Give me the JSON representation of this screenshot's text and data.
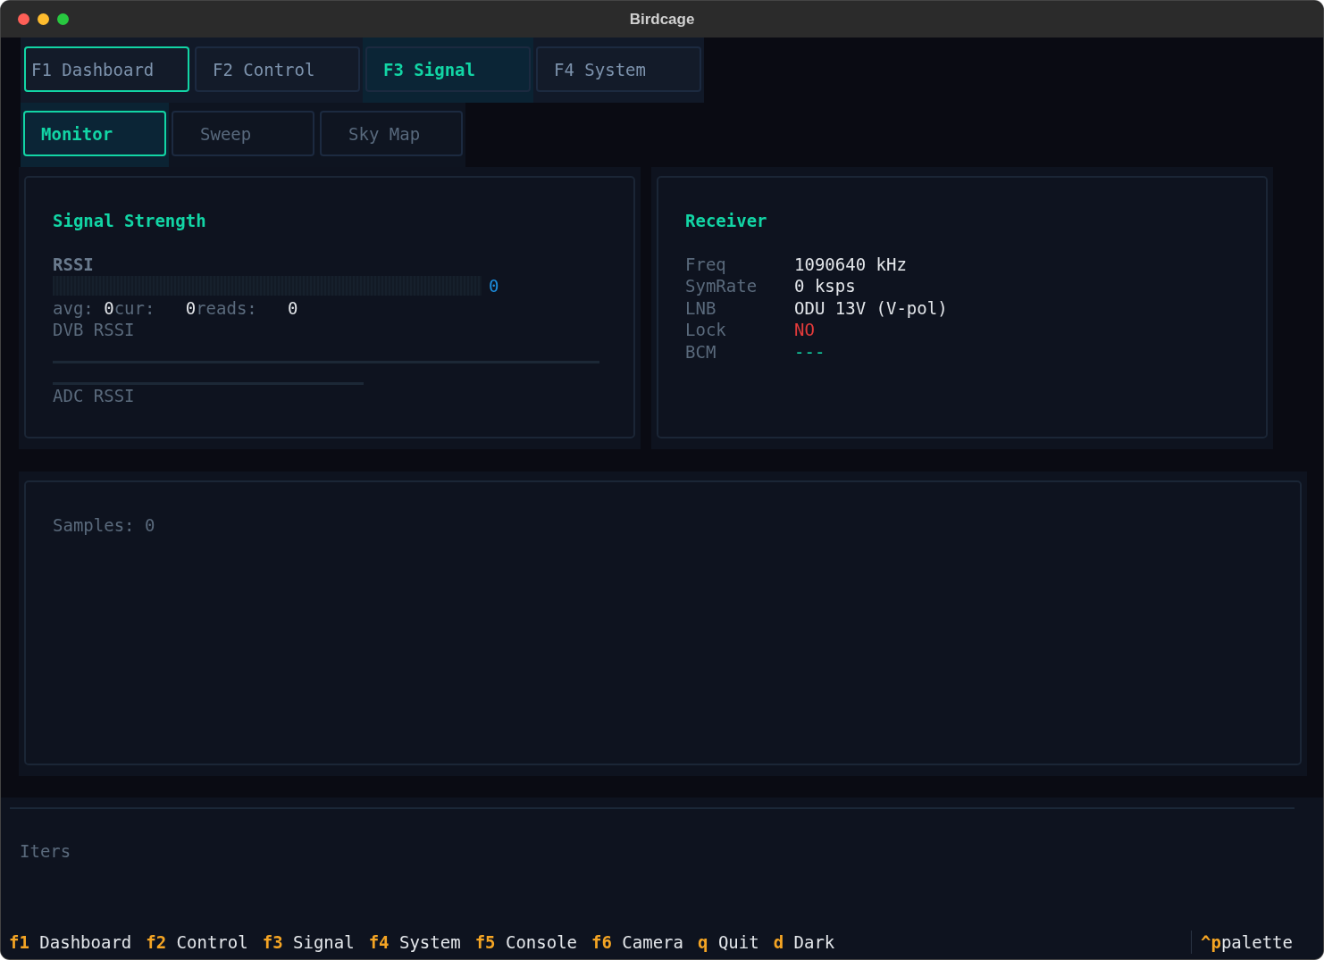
{
  "window": {
    "title": "Birdcage"
  },
  "tabs": [
    {
      "label": "F1 Dashboard",
      "selected": false,
      "focused": true
    },
    {
      "label": "F2 Control",
      "selected": false,
      "focused": false
    },
    {
      "label": "F3 Signal",
      "selected": true,
      "focused": false
    },
    {
      "label": "F4 System",
      "selected": false,
      "focused": false
    }
  ],
  "subtabs": [
    {
      "label": "Monitor",
      "selected": true
    },
    {
      "label": "Sweep",
      "selected": false
    },
    {
      "label": "Sky Map",
      "selected": false
    }
  ],
  "signal_panel": {
    "title": "Signal Strength",
    "rssi": {
      "label": "RSSI",
      "level": 0,
      "value": "0"
    },
    "stats": [
      {
        "label": "avg:",
        "value": "0"
      },
      {
        "label": "cur:",
        "value": "0"
      },
      {
        "label": "reads:",
        "value": "0"
      }
    ],
    "dvb_label": "DVB RSSI",
    "adc_label": "ADC RSSI"
  },
  "receiver_panel": {
    "title": "Receiver",
    "rows": [
      {
        "key": "Freq",
        "value": "1090640 kHz",
        "color": "#e3e6ea"
      },
      {
        "key": "SymRate",
        "value": "0 ksps",
        "color": "#e3e6ea"
      },
      {
        "key": "LNB",
        "value": "ODU 13V (V-pol)",
        "color": "#e3e6ea"
      },
      {
        "key": "Lock",
        "value": "NO",
        "color": "#e53b3b"
      },
      {
        "key": "BCM",
        "value": "---",
        "color": "#12d5a5"
      }
    ]
  },
  "samples": "Samples: 0",
  "footer": {
    "label": "Iters"
  },
  "key_bar": {
    "keys": [
      {
        "key": "f1",
        "label": "Dashboard"
      },
      {
        "key": "f2",
        "label": "Control"
      },
      {
        "key": "f3",
        "label": "Signal"
      },
      {
        "key": "f4",
        "label": "System"
      },
      {
        "key": "f5",
        "label": "Console"
      },
      {
        "key": "f6",
        "label": "Camera"
      },
      {
        "key": "q",
        "label": "Quit"
      },
      {
        "key": "d",
        "label": "Dark"
      }
    ],
    "palette": {
      "key": "^p",
      "label": "palette"
    }
  }
}
